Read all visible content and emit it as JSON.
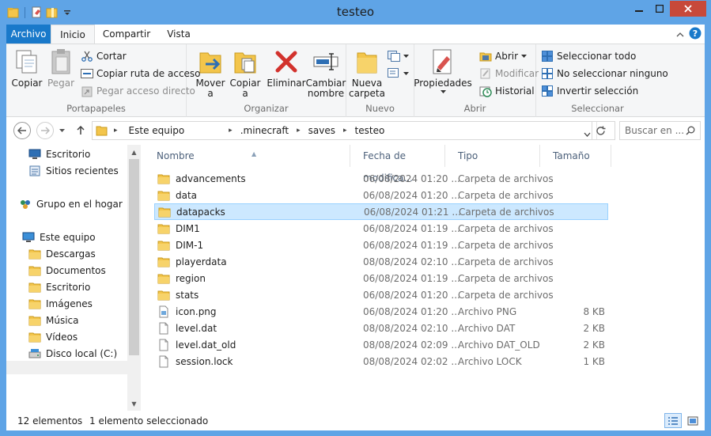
{
  "window": {
    "title": "testeo"
  },
  "tabs": [
    "Archivo",
    "Inicio",
    "Compartir",
    "Vista"
  ],
  "ribbon": {
    "portapapeles": {
      "label": "Portapapeles",
      "copiar": "Copiar",
      "pegar": "Pegar",
      "cortar": "Cortar",
      "copiar_ruta": "Copiar ruta de acceso",
      "pegar_acceso": "Pegar acceso directo"
    },
    "organizar": {
      "label": "Organizar",
      "mover_a": "Mover",
      "mover_a2": "a",
      "copiar_a": "Copiar",
      "copiar_a2": "a",
      "eliminar": "Eliminar",
      "cambiar_nombre": "Cambiar",
      "cambiar_nombre2": "nombre"
    },
    "nuevo": {
      "label": "Nuevo",
      "nueva_carpeta": "Nueva",
      "nueva_carpeta2": "carpeta"
    },
    "abrir": {
      "label": "Abrir",
      "propiedades": "Propiedades",
      "abrir": "Abrir",
      "modificar": "Modificar",
      "historial": "Historial"
    },
    "seleccionar": {
      "label": "Seleccionar",
      "todo": "Seleccionar todo",
      "ninguno": "No seleccionar ninguno",
      "invertir": "Invertir selección"
    }
  },
  "address": {
    "path": [
      "Este equipo",
      ".minecraft",
      "saves",
      "testeo"
    ],
    "search_placeholder": "Buscar en ..."
  },
  "nav": [
    {
      "label": "Escritorio",
      "icon": "desktop-icon"
    },
    {
      "label": "Sitios recientes",
      "icon": "recent-icon"
    },
    {
      "label": "Grupo en el hogar",
      "icon": "homegroup-icon"
    },
    {
      "label": "Este equipo",
      "icon": "computer-icon"
    },
    {
      "label": "Descargas",
      "icon": "folder-icon"
    },
    {
      "label": "Documentos",
      "icon": "folder-icon"
    },
    {
      "label": "Escritorio",
      "icon": "folder-icon"
    },
    {
      "label": "Imágenes",
      "icon": "folder-icon"
    },
    {
      "label": "Música",
      "icon": "folder-icon"
    },
    {
      "label": "Vídeos",
      "icon": "folder-icon"
    },
    {
      "label": "Disco local (C:)",
      "icon": "drive-icon"
    }
  ],
  "columns": [
    "Nombre",
    "Fecha de modifica...",
    "Tipo",
    "Tamaño"
  ],
  "files": [
    {
      "name": "advancements",
      "date": "06/08/2024 01:20 ...",
      "type": "Carpeta de archivos",
      "size": "",
      "kind": "folder"
    },
    {
      "name": "data",
      "date": "06/08/2024 01:20 ...",
      "type": "Carpeta de archivos",
      "size": "",
      "kind": "folder"
    },
    {
      "name": "datapacks",
      "date": "06/08/2024 01:21 ...",
      "type": "Carpeta de archivos",
      "size": "",
      "kind": "folder",
      "selected": true
    },
    {
      "name": "DIM1",
      "date": "06/08/2024 01:19 ...",
      "type": "Carpeta de archivos",
      "size": "",
      "kind": "folder"
    },
    {
      "name": "DIM-1",
      "date": "06/08/2024 01:19 ...",
      "type": "Carpeta de archivos",
      "size": "",
      "kind": "folder"
    },
    {
      "name": "playerdata",
      "date": "08/08/2024 02:10 ...",
      "type": "Carpeta de archivos",
      "size": "",
      "kind": "folder"
    },
    {
      "name": "region",
      "date": "06/08/2024 01:19 ...",
      "type": "Carpeta de archivos",
      "size": "",
      "kind": "folder"
    },
    {
      "name": "stats",
      "date": "06/08/2024 01:20 ...",
      "type": "Carpeta de archivos",
      "size": "",
      "kind": "folder"
    },
    {
      "name": "icon.png",
      "date": "06/08/2024 01:20 ...",
      "type": "Archivo PNG",
      "size": "8 KB",
      "kind": "file"
    },
    {
      "name": "level.dat",
      "date": "08/08/2024 02:10 ...",
      "type": "Archivo DAT",
      "size": "2 KB",
      "kind": "file"
    },
    {
      "name": "level.dat_old",
      "date": "08/08/2024 02:09 ...",
      "type": "Archivo DAT_OLD",
      "size": "2 KB",
      "kind": "file"
    },
    {
      "name": "session.lock",
      "date": "08/08/2024 02:02 ...",
      "type": "Archivo LOCK",
      "size": "1 KB",
      "kind": "file"
    }
  ],
  "status": {
    "count": "12 elementos",
    "selection": "1 elemento seleccionado"
  },
  "colors": {
    "titlebar": "#5fa4e6",
    "archivo_tab": "#1979ca",
    "close": "#c7493a",
    "selection": "#cce8ff",
    "folder": "#f3c54b"
  }
}
